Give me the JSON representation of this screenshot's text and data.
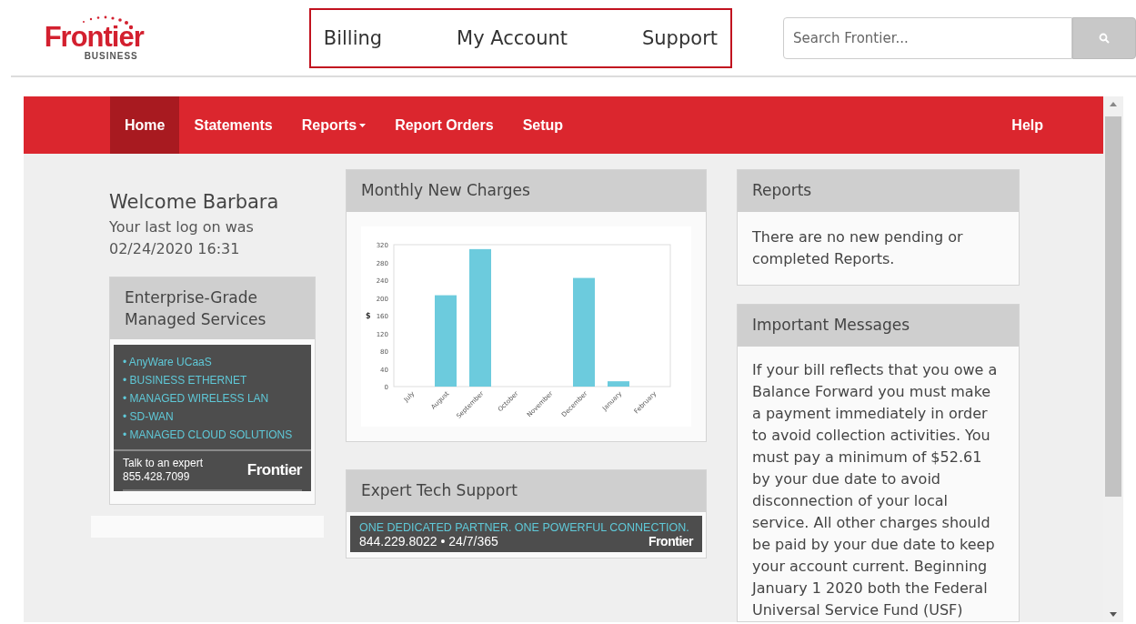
{
  "logo": {
    "name": "Frontier",
    "tagline": "BUSINESS"
  },
  "top_nav": [
    {
      "label": "Billing"
    },
    {
      "label": "My Account"
    },
    {
      "label": "Support"
    }
  ],
  "search": {
    "placeholder": "Search Frontier..."
  },
  "menu": [
    {
      "label": "Home",
      "selected": true,
      "dropdown": false
    },
    {
      "label": "Statements",
      "selected": false,
      "dropdown": false
    },
    {
      "label": "Reports",
      "selected": false,
      "dropdown": true
    },
    {
      "label": "Report Orders",
      "selected": false,
      "dropdown": false
    },
    {
      "label": "Setup",
      "selected": false,
      "dropdown": false
    }
  ],
  "help": {
    "label": "Help"
  },
  "welcome": {
    "title": "Welcome Barbara",
    "line_1": "Your last log on was",
    "line_2": "02/24/2020 16:31"
  },
  "promo": {
    "title": "Enterprise-Grade Managed Services",
    "items": [
      "• AnyWare UCaaS",
      "• BUSINESS ETHERNET",
      "• MANAGED WIRELESS LAN",
      "• SD-WAN",
      "• MANAGED CLOUD SOLUTIONS"
    ],
    "contact": "Talk to an expert",
    "phone": "855.428.7099",
    "brand": "Frontier"
  },
  "charges": {
    "title": "Monthly New Charges",
    "chart_data": {
      "type": "bar",
      "ylabel": "$",
      "categories": [
        "July",
        "August",
        "September",
        "October",
        "November",
        "December",
        "January",
        "February"
      ],
      "values": [
        0,
        206,
        310,
        0,
        0,
        245,
        12,
        0
      ],
      "ylim": [
        0,
        320
      ],
      "yticks": [
        0,
        40,
        80,
        120,
        160,
        200,
        240,
        280,
        320
      ]
    }
  },
  "tech_support": {
    "title": "Expert Tech Support",
    "tagline": "ONE DEDICATED PARTNER. ONE POWERFUL CONNECTION.",
    "phone": "844.229.8022 • 24/7/365",
    "brand": "Frontier"
  },
  "reports": {
    "title": "Reports",
    "message": "There are no new pending or completed Reports."
  },
  "messages": {
    "title": "Important Messages",
    "message": "If your bill reflects that you owe a Balance Forward you must make a payment immediately in order to avoid collection activities. You must pay a minimum of $52.61 by your due date to avoid disconnection of your local service. All other charges should be paid by your due date to keep your account current. Beginning January 1 2020 both the Federal Universal Service Fund (USF)"
  }
}
